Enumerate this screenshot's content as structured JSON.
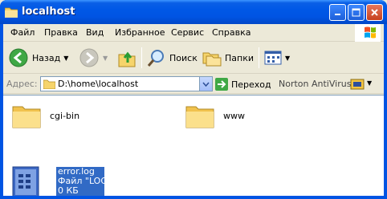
{
  "window": {
    "title": "localhost"
  },
  "menu": {
    "items": [
      {
        "label": "Файл"
      },
      {
        "label": "Правка"
      },
      {
        "label": "Вид"
      },
      {
        "label": "Избранное"
      },
      {
        "label": "Сервис"
      },
      {
        "label": "Справка"
      }
    ]
  },
  "toolbar": {
    "back_label": "Назад",
    "search_label": "Поиск",
    "folders_label": "Папки"
  },
  "address": {
    "label": "Адрес:",
    "value": "D:\\home\\localhost",
    "go_label": "Переход",
    "norton_label": "Norton AntiVirus"
  },
  "files": [
    {
      "name": "cgi-bin",
      "type": "folder"
    },
    {
      "name": "www",
      "type": "folder"
    },
    {
      "name": "error.log",
      "type": "file",
      "subtitle": "Файл \"LOG\"",
      "size": "0 КБ",
      "selected": true
    }
  ],
  "colors": {
    "titlebar": "#0054e3",
    "selection": "#316ac5",
    "folder": "#f8d775"
  }
}
